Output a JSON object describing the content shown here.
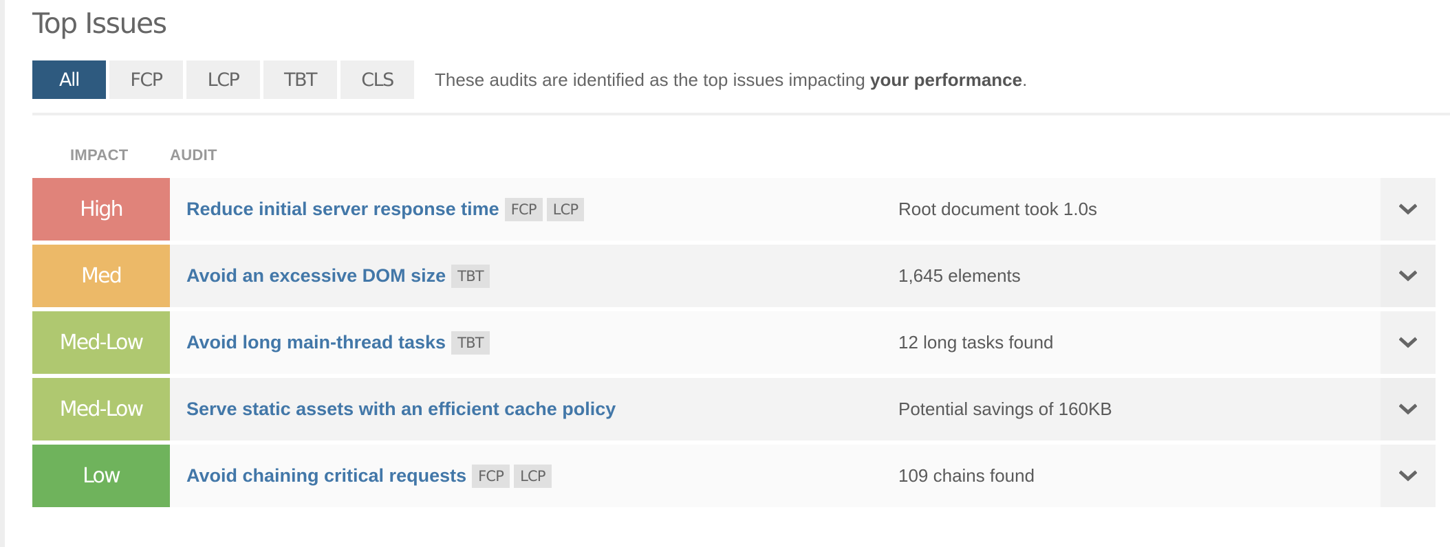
{
  "header": {
    "title": "Top Issues"
  },
  "tabs": [
    {
      "label": "All",
      "active": true
    },
    {
      "label": "FCP",
      "active": false
    },
    {
      "label": "LCP",
      "active": false
    },
    {
      "label": "TBT",
      "active": false
    },
    {
      "label": "CLS",
      "active": false
    }
  ],
  "description": {
    "prefix": "These audits are identified as the top issues impacting ",
    "emphasis": "your performance",
    "suffix": "."
  },
  "columns": {
    "impact": "IMPACT",
    "audit": "AUDIT"
  },
  "colors": {
    "active_tab": "#2e5a7f",
    "audit_link": "#4277a8",
    "impact_high": "#e0837a",
    "impact_med": "#ecb968",
    "impact_med_low": "#afc870",
    "impact_low": "#6fb35c"
  },
  "issues": [
    {
      "impact": "High",
      "impact_color": "#e0837a",
      "title": "Reduce initial server response time",
      "tags": [
        "FCP",
        "LCP"
      ],
      "detail": "Root document took 1.0s",
      "expand_icon": "chevron-down-icon"
    },
    {
      "impact": "Med",
      "impact_color": "#ecb968",
      "title": "Avoid an excessive DOM size",
      "tags": [
        "TBT"
      ],
      "detail": "1,645 elements",
      "expand_icon": "chevron-down-icon"
    },
    {
      "impact": "Med-Low",
      "impact_color": "#afc870",
      "title": "Avoid long main-thread tasks",
      "tags": [
        "TBT"
      ],
      "detail": "12 long tasks found",
      "expand_icon": "chevron-down-icon"
    },
    {
      "impact": "Med-Low",
      "impact_color": "#afc870",
      "title": "Serve static assets with an efficient cache policy",
      "tags": [],
      "detail": "Potential savings of 160KB",
      "expand_icon": "chevron-down-icon"
    },
    {
      "impact": "Low",
      "impact_color": "#6fb35c",
      "title": "Avoid chaining critical requests",
      "tags": [
        "FCP",
        "LCP"
      ],
      "detail": "109 chains found",
      "expand_icon": "chevron-down-icon"
    }
  ]
}
